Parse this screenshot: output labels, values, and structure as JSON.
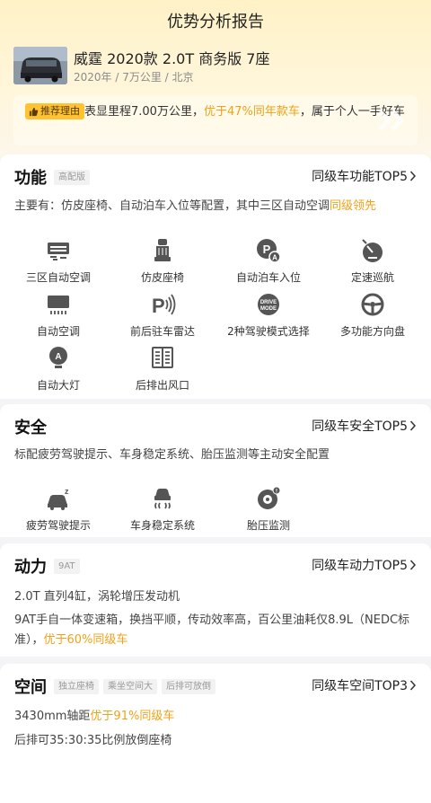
{
  "page": {
    "title": "优势分析报告"
  },
  "car": {
    "name": "威霆 2020款 2.0T 商务版 7座",
    "meta": "2020年 / 7万公里 / 北京"
  },
  "reason": {
    "tag": "推荐理由",
    "text_a": "表显里程7.00万公里，",
    "text_hl": "优于47%同年款车",
    "text_b": "，属于个人一手好车"
  },
  "function": {
    "title": "功能",
    "tag": "高配版",
    "link": "同级车功能TOP5",
    "desc_a": "主要有：仿皮座椅、自动泊车入位等配置，其中三区自动空调",
    "desc_hl": "同级领先",
    "features": [
      {
        "label": "三区自动空调",
        "icon": "climate-vent-icon"
      },
      {
        "label": "仿皮座椅",
        "icon": "seat-icon"
      },
      {
        "label": "自动泊车入位",
        "icon": "auto-park-icon"
      },
      {
        "label": "定速巡航",
        "icon": "speedometer-icon"
      },
      {
        "label": "自动空调",
        "icon": "ac-icon"
      },
      {
        "label": "前后驻车雷达",
        "icon": "parking-radar-icon"
      },
      {
        "label": "2种驾驶模式选择",
        "icon": "drive-mode-icon"
      },
      {
        "label": "多功能方向盘",
        "icon": "steering-wheel-icon"
      },
      {
        "label": "自动大灯",
        "icon": "auto-headlight-icon"
      },
      {
        "label": "后排出风口",
        "icon": "rear-vent-icon"
      }
    ]
  },
  "safety": {
    "title": "安全",
    "link": "同级车安全TOP5",
    "desc": "标配疲劳驾驶提示、车身稳定系统、胎压监测等主动安全配置",
    "features": [
      {
        "label": "疲劳驾驶提示",
        "icon": "fatigue-icon"
      },
      {
        "label": "车身稳定系统",
        "icon": "stability-icon"
      },
      {
        "label": "胎压监测",
        "icon": "tire-pressure-icon"
      }
    ]
  },
  "power": {
    "title": "动力",
    "tag": "9AT",
    "link": "同级车动力TOP5",
    "line1": "2.0T 直列4缸，涡轮增压发动机",
    "line2_a": "9AT手自一体变速箱，换挡平顺，传动效率高，百公里油耗仅8.9L（NEDC标准），",
    "line2_hl": "优于60%同级车"
  },
  "space": {
    "title": "空间",
    "tags": [
      "独立座椅",
      "乘坐空间大",
      "后排可放倒"
    ],
    "link": "同级车空间TOP3",
    "line1_a": "3430mm轴距",
    "line1_hl": "优于91%同级车",
    "line2": "后排可35:30:35比例放倒座椅"
  },
  "colors": {
    "accent": "#f0a218",
    "tag_bg": "#ffc233",
    "hero_bg": "#fff2c7"
  }
}
